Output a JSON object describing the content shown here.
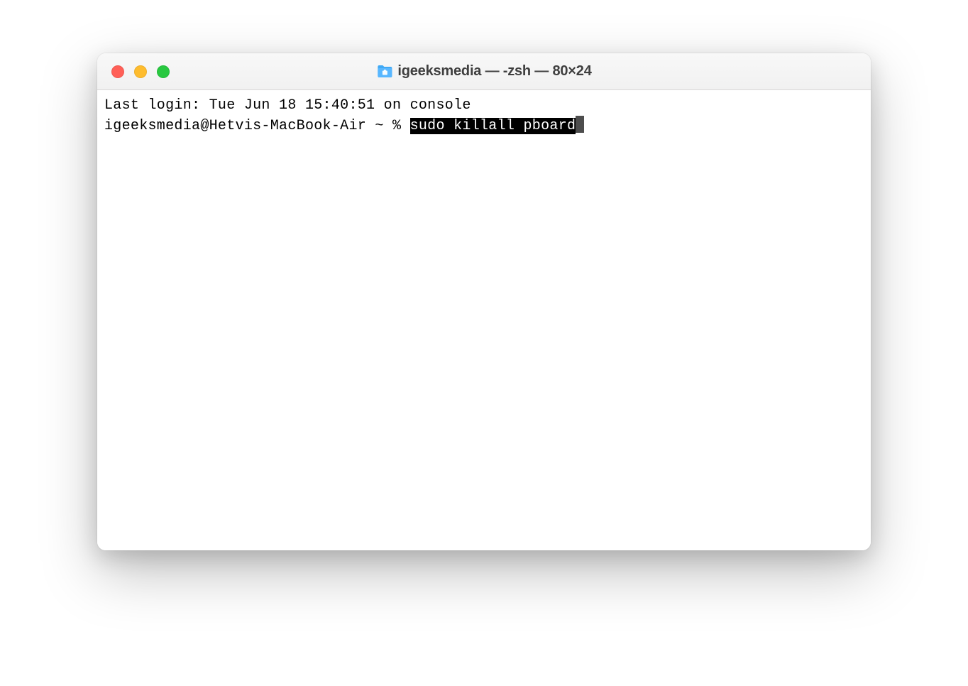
{
  "window": {
    "title": "igeeksmedia — -zsh — 80×24"
  },
  "terminal": {
    "last_login_line": "Last login: Tue Jun 18 15:40:51 on console",
    "prompt": "igeeksmedia@Hetvis-MacBook-Air ~ % ",
    "command_highlighted": "sudo killall pboard"
  }
}
